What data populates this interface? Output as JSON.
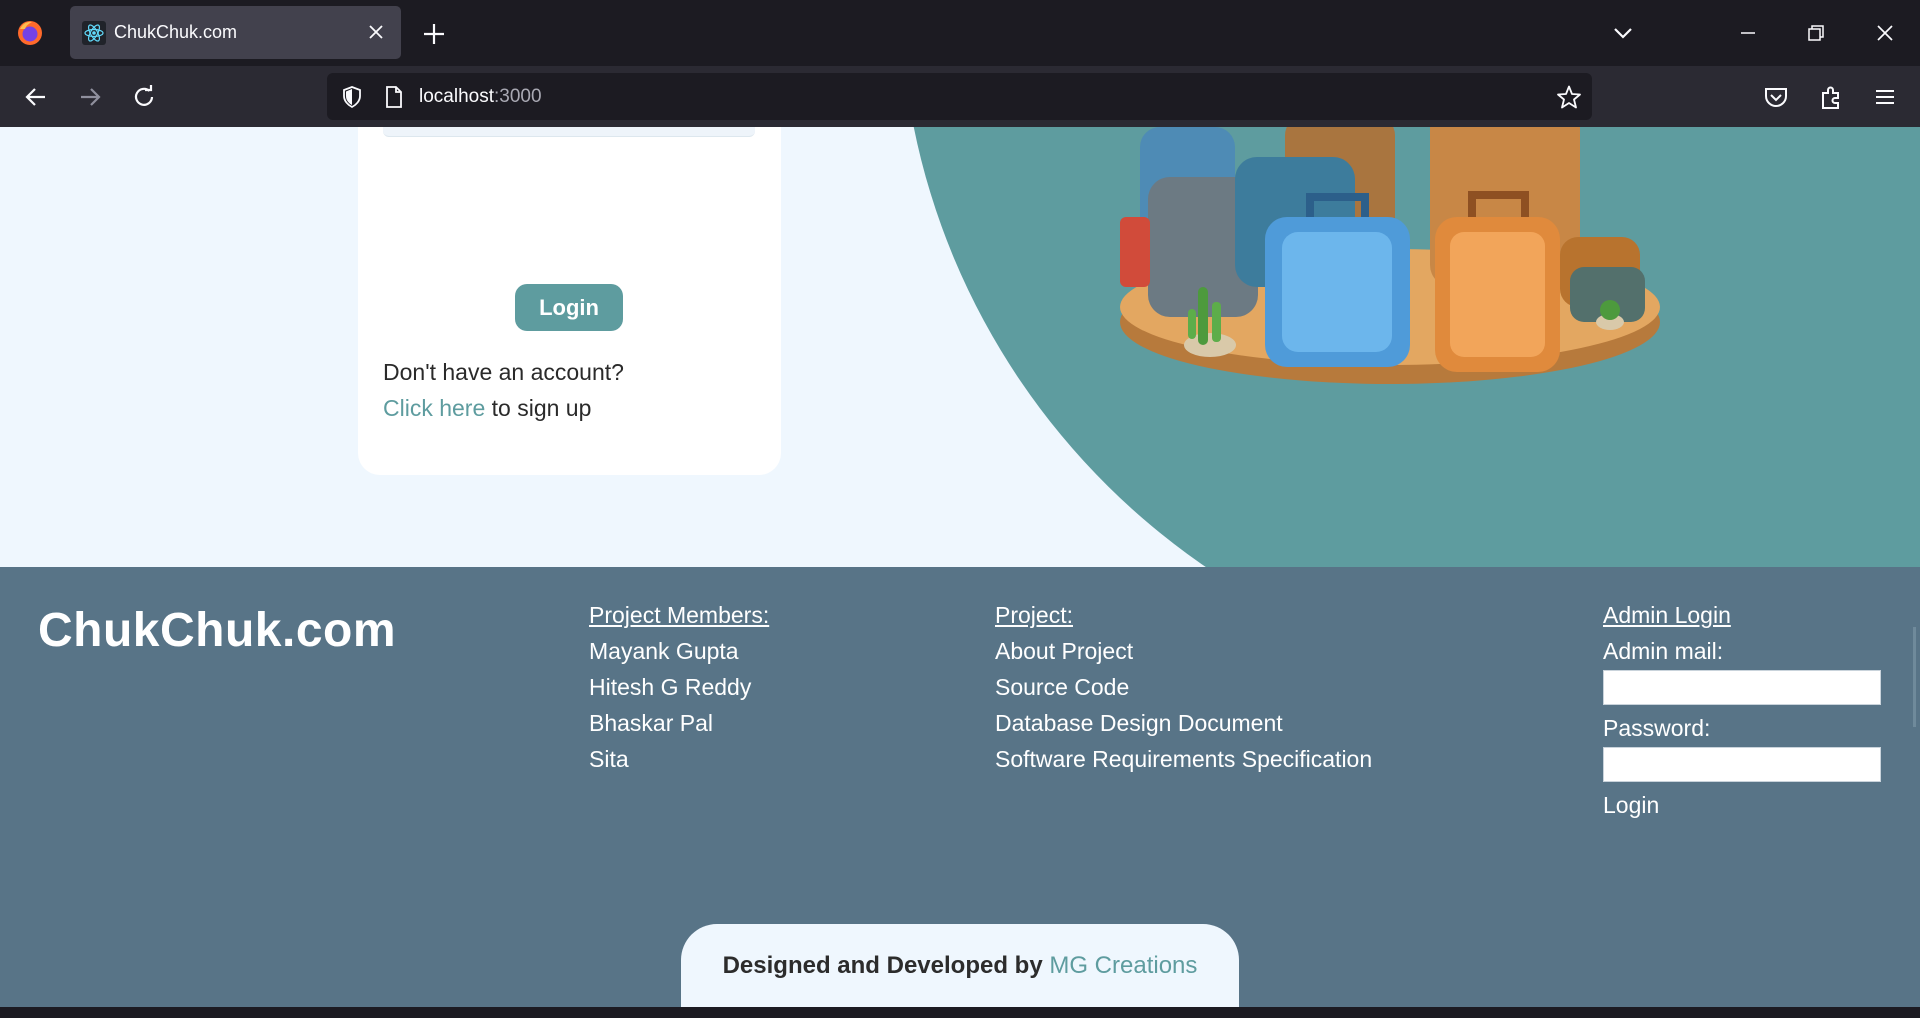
{
  "browser": {
    "tab_title": "ChukChuk.com",
    "url_host": "localhost",
    "url_port": ":3000",
    "icons": [
      "firefox-logo",
      "react-favicon",
      "close-icon",
      "plus-icon",
      "chevron-down-icon",
      "minimize-icon",
      "restore-icon",
      "window-close-icon",
      "back-arrow-icon",
      "forward-arrow-icon",
      "reload-icon",
      "shield-icon",
      "page-icon",
      "star-icon",
      "pocket-icon",
      "extensions-icon",
      "menu-icon"
    ]
  },
  "login_card": {
    "login_button": "Login",
    "no_account_text": "Don't have an account?",
    "signup_link": "Click here",
    "signup_suffix": " to sign up"
  },
  "footer": {
    "brand": "ChukChuk.com",
    "members": {
      "heading": "Project Members:",
      "items": [
        "Mayank Gupta",
        "Hitesh G Reddy",
        "Bhaskar Pal",
        "Sita"
      ]
    },
    "project": {
      "heading": "Project:",
      "items": [
        "About Project",
        "Source Code",
        "Database Design Document",
        "Software Requirements Specification"
      ]
    },
    "admin": {
      "heading": "Admin Login",
      "mail_label": "Admin mail:",
      "password_label": "Password:",
      "login": "Login"
    },
    "credit": {
      "prefix": "Designed and Developed by ",
      "brand": "MG Creations"
    }
  },
  "colors": {
    "accent": "#5e9c9f",
    "footer_bg": "#587487",
    "page_bg": "#eff7fe"
  }
}
